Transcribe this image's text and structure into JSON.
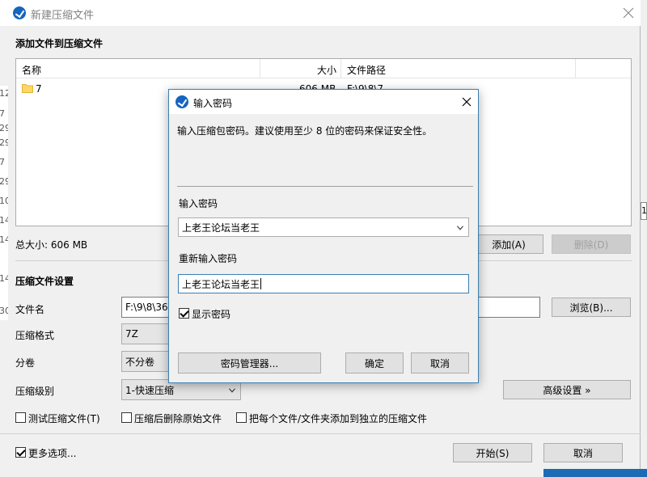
{
  "window": {
    "title": "新建压缩文件"
  },
  "add_section": {
    "title": "添加文件到压缩文件"
  },
  "file_table": {
    "headers": {
      "name": "名称",
      "size": "大小",
      "path": "文件路径"
    },
    "rows": [
      {
        "name": "7",
        "size": "606 MB",
        "path": "F:\\9\\8\\7"
      }
    ]
  },
  "total_size": "总大小: 606 MB",
  "add_button": "添加(A)",
  "delete_button": "删除(D)",
  "settings": {
    "title": "压缩文件设置",
    "filename_label": "文件名",
    "filename_value": "F:\\9\\8\\36",
    "browse_button": "浏览(B)...",
    "format_label": "压缩格式",
    "format_value": "7Z",
    "volume_label": "分卷",
    "volume_value": "不分卷",
    "level_label": "压缩级别",
    "level_value": "1-快速压缩",
    "advanced_button": "高级设置 »"
  },
  "options": {
    "test_label": "测试压缩文件(T)",
    "delete_after_label": "压缩后删除原始文件",
    "separate_label": "把每个文件/文件夹添加到独立的压缩文件",
    "more_label": "更多选项..."
  },
  "start_button": "开始(S)",
  "cancel_button": "取消",
  "dialog": {
    "title": "输入密码",
    "description": "输入压缩包密码。建议使用至少 8 位的密码来保证安全性。",
    "password_label": "输入密码",
    "password_value": "上老王论坛当老王",
    "repeat_label": "重新输入密码",
    "repeat_value": "上老王论坛当老王",
    "show_password_label": "显示密码",
    "manager_button": "密码管理器...",
    "ok_button": "确定",
    "cancel_button": "取消"
  },
  "edge_fragments": {
    "left": [
      "12",
      "7",
      "29",
      "29",
      "7",
      "29",
      "10",
      "14",
      "14",
      "14",
      "30"
    ],
    "right": "1"
  },
  "colors": {
    "accent": "#1565c0",
    "dialog_border": "#3c7fb1",
    "folder": "#ffd763"
  }
}
